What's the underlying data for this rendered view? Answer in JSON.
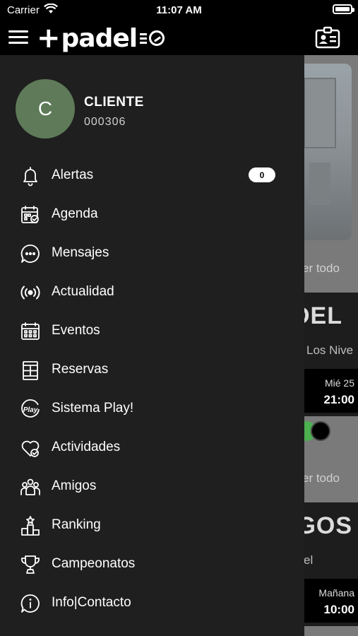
{
  "status_bar": {
    "carrier": "Carrier",
    "time": "11:07 AM"
  },
  "header": {
    "logo_text": "padel"
  },
  "user": {
    "initial": "C",
    "name": "CLIENTE",
    "id": "000306"
  },
  "menu": [
    {
      "label": "Alertas",
      "icon": "bell-icon",
      "badge": "0"
    },
    {
      "label": "Agenda",
      "icon": "calendar-check-icon"
    },
    {
      "label": "Mensajes",
      "icon": "chat-bubble-icon"
    },
    {
      "label": "Actualidad",
      "icon": "broadcast-icon"
    },
    {
      "label": "Eventos",
      "icon": "calendar-grid-icon"
    },
    {
      "label": "Reservas",
      "icon": "court-icon"
    },
    {
      "label": "Sistema Play!",
      "icon": "play-badge-icon"
    },
    {
      "label": "Actividades",
      "icon": "heart-check-icon"
    },
    {
      "label": "Amigos",
      "icon": "friends-icon"
    },
    {
      "label": "Ranking",
      "icon": "podium-icon"
    },
    {
      "label": "Campeonatos",
      "icon": "trophy-icon"
    },
    {
      "label": "Info|Contacto",
      "icon": "info-icon"
    }
  ],
  "background": {
    "see_all_1": "er todo",
    "card1": {
      "title": "DEL",
      "subtitle": "Los Nive",
      "date": "Mié 25",
      "time": "21:00"
    },
    "see_all_2": "er todo",
    "card2": {
      "title": "IGOS",
      "subtitle": "el",
      "date": "Mañana",
      "time": "10:00"
    }
  },
  "colors": {
    "drawer_bg": "#1f1f1f",
    "avatar_bg": "#5e7a58",
    "accent_green": "#4caf50"
  }
}
